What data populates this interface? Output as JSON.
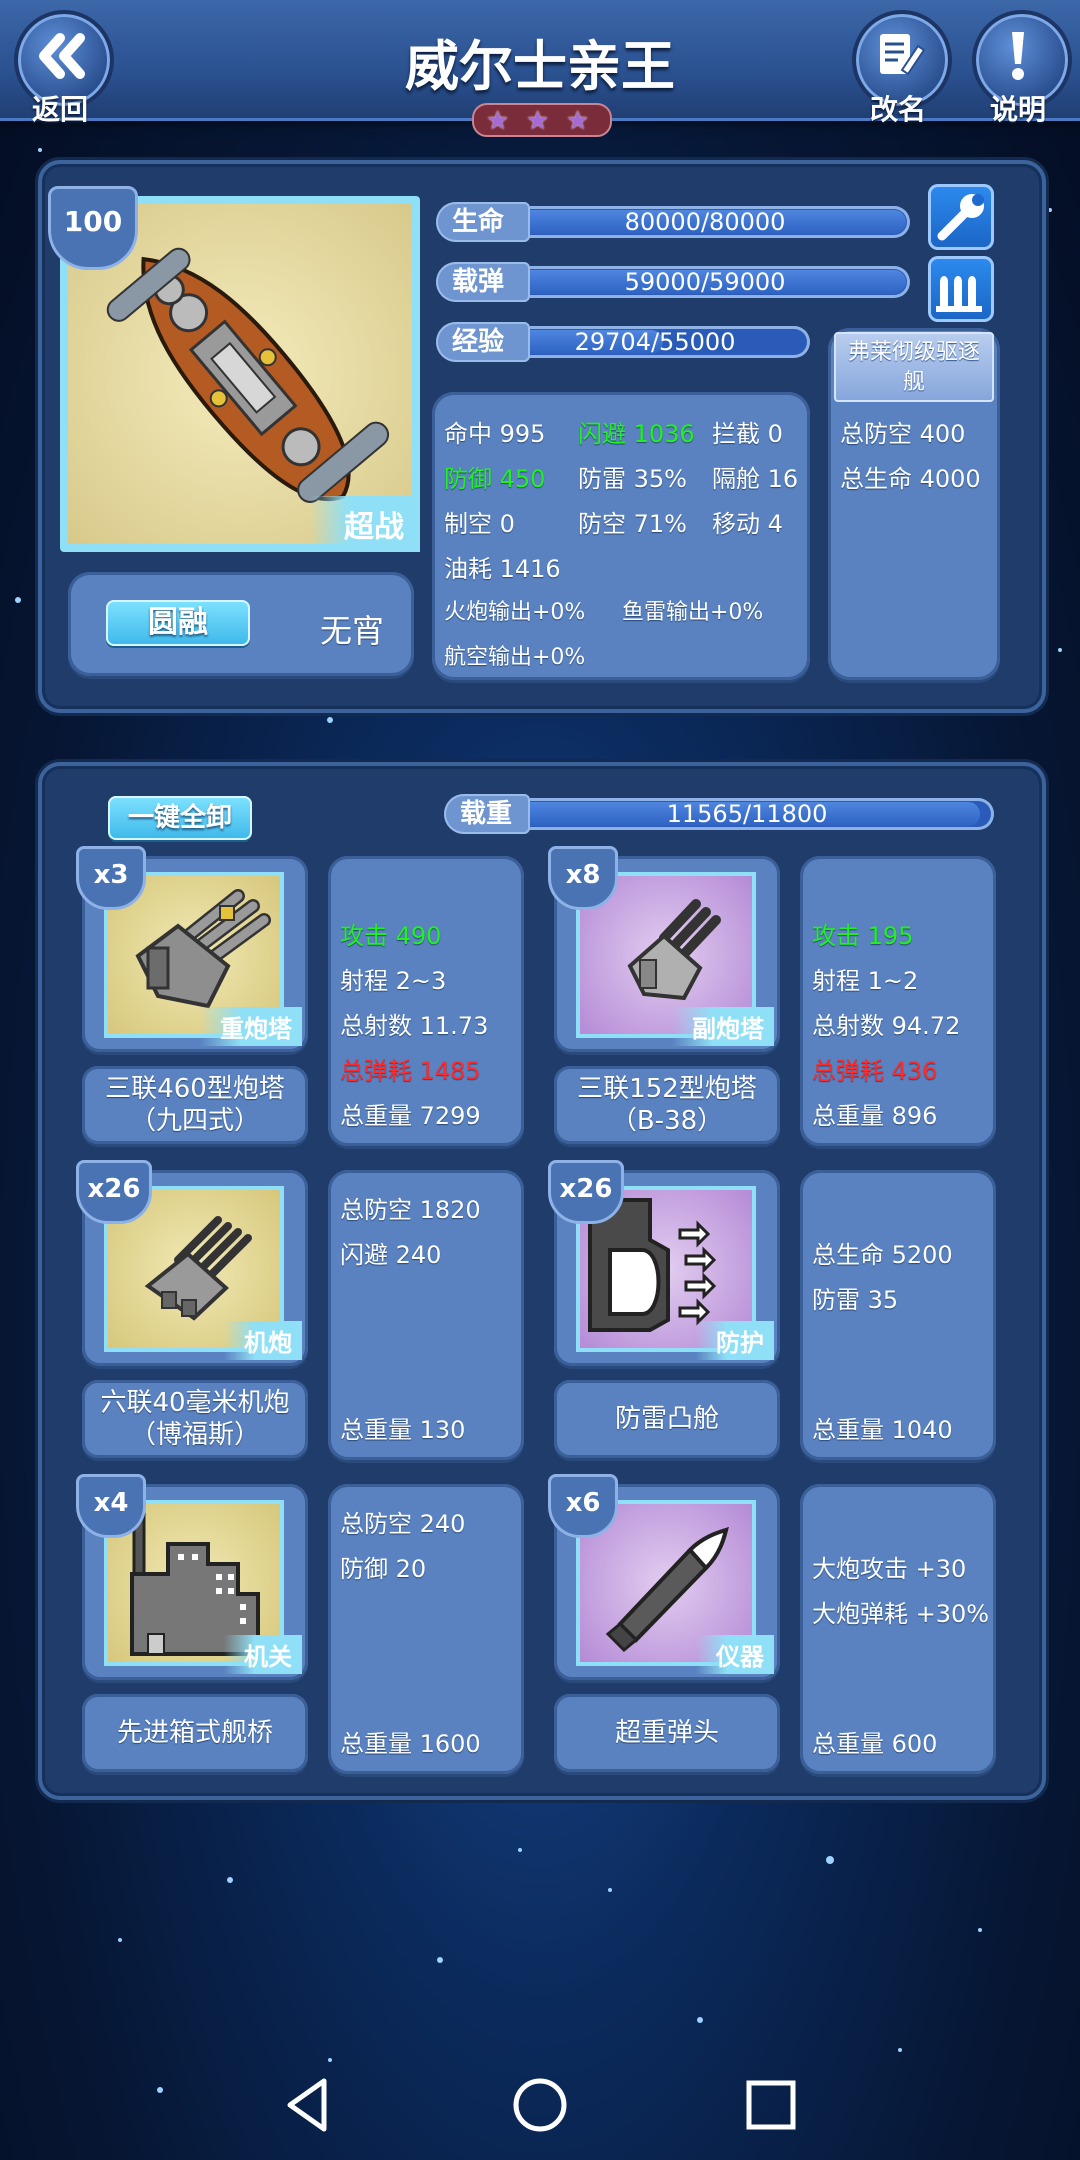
{
  "header": {
    "title": "威尔士亲王",
    "back_label": "返回",
    "rename_label": "改名",
    "help_label": "说明",
    "star_count": 3
  },
  "ship": {
    "level": "100",
    "class_tag": "超战",
    "trait": "圆融",
    "trait_value": "无宵",
    "bars": {
      "hp": {
        "label": "生命",
        "value": "80000/80000",
        "fraction": 1.0
      },
      "ammo": {
        "label": "载弹",
        "value": "59000/59000",
        "fraction": 1.0
      },
      "exp": {
        "label": "经验",
        "value": "29704/55000",
        "fraction": 0.54
      }
    },
    "stats": {
      "r1": [
        "命中 995",
        "闪避 1036",
        "拦截 0"
      ],
      "r2": [
        "防御 450",
        "防雷 35%",
        "隔舱 16"
      ],
      "r3": [
        "制空 0",
        "防空 71%",
        "移动 4"
      ],
      "r4": [
        "油耗 1416"
      ],
      "r5": [
        "火炮输出+0%",
        "鱼雷输出+0%"
      ],
      "r6": [
        "航空输出+0%"
      ]
    },
    "escort": {
      "name": "弗莱彻级驱逐舰",
      "stat1": "总防空 400",
      "stat2": "总生命 4000"
    }
  },
  "loadout": {
    "unequip_all_label": "一键全卸",
    "weight": {
      "label": "载重",
      "value": "11565/11800",
      "fraction": 0.98
    },
    "items": [
      {
        "count": "x3",
        "type": "重炮塔",
        "name": "三联460型炮塔（九四式）",
        "stats": [
          "攻击 490",
          "射程 2~3",
          "总射数 11.73",
          "总弹耗 1485"
        ],
        "weight": "总重量 7299"
      },
      {
        "count": "x8",
        "type": "副炮塔",
        "name": "三联152型炮塔（B-38）",
        "stats": [
          "攻击 195",
          "射程 1~2",
          "总射数 94.72",
          "总弹耗 436"
        ],
        "weight": "总重量 896"
      },
      {
        "count": "x26",
        "type": "机炮",
        "name": "六联40毫米机炮（博福斯）",
        "stats": [
          "总防空 1820",
          "闪避 240"
        ],
        "weight": "总重量 130"
      },
      {
        "count": "x26",
        "type": "防护",
        "name": "防雷凸舱",
        "stats": [
          "总生命 5200",
          "防雷 35"
        ],
        "weight": "总重量 1040"
      },
      {
        "count": "x4",
        "type": "机关",
        "name": "先进箱式舰桥",
        "stats": [
          "总防空 240",
          "防御 20"
        ],
        "weight": "总重量 1600"
      },
      {
        "count": "x6",
        "type": "仪器",
        "name": "超重弹头",
        "stats": [
          "大炮攻击 +30",
          "大炮弹耗 +30%"
        ],
        "weight": "总重量 600"
      }
    ]
  },
  "colors": {
    "accent_green": "#22f022",
    "accent_red": "#ff2b2b",
    "panel": "#5a82c1"
  }
}
